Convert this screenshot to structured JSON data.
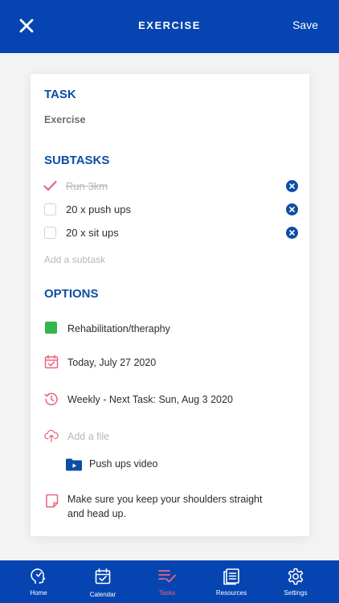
{
  "header": {
    "title": "EXERCISE",
    "save_label": "Save"
  },
  "task": {
    "section_title": "TASK",
    "name": "Exercise"
  },
  "subtasks": {
    "section_title": "SUBTASKS",
    "items": [
      {
        "label": "Run 3km",
        "done": true
      },
      {
        "label": "20 x push ups",
        "done": false
      },
      {
        "label": "20 x sit ups",
        "done": false
      }
    ],
    "add_placeholder": "Add a subtask"
  },
  "options": {
    "section_title": "OPTIONS",
    "category": {
      "label": "Rehabilitation/theraphy",
      "color": "#34b54a"
    },
    "date": "Today, July 27 2020",
    "repeat": "Weekly - Next Task: Sun, Aug 3 2020",
    "add_file": "Add a file",
    "attachment": "Push ups video",
    "note": "Make sure you keep your shoulders straight and head up."
  },
  "tabs": [
    {
      "label": "Home",
      "icon": "head-icon",
      "active": false
    },
    {
      "label": "Calendar",
      "icon": "calendar-check-icon",
      "active": false
    },
    {
      "label": "Tasks",
      "icon": "task-list-icon",
      "active": true
    },
    {
      "label": "Resources",
      "icon": "resources-icon",
      "active": false
    },
    {
      "label": "Settings",
      "icon": "gear-icon",
      "active": false
    }
  ],
  "colors": {
    "brand": "#0645b1",
    "accent": "#e8657d",
    "heading": "#0c4ea6"
  }
}
